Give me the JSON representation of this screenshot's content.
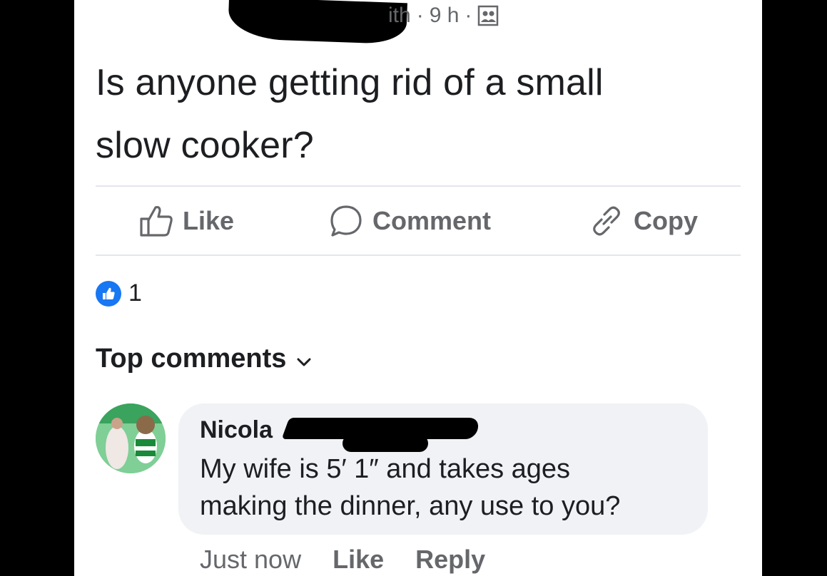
{
  "post": {
    "meta_name_fragment": "ith",
    "meta_time": "9 h",
    "text_line1": "Is anyone getting rid of a small",
    "text_line2": "slow cooker?"
  },
  "actions": {
    "like_label": "Like",
    "comment_label": "Comment",
    "copy_label": "Copy"
  },
  "reactions": {
    "count": "1"
  },
  "comments_section": {
    "label": "Top comments"
  },
  "comment": {
    "author": "Nicola",
    "text_line1": "My wife  is 5′ 1″ and takes ages",
    "text_line2": "making the dinner, any use to you?",
    "time": "Just now",
    "like_label": "Like",
    "reply_label": "Reply"
  },
  "icons": {
    "like": "thumbs-up-icon",
    "comment": "speech-bubble-icon",
    "copy": "link-icon",
    "audience": "friends-icon",
    "chevron": "chevron-down-icon"
  },
  "colors": {
    "background": "#000000",
    "panel": "#ffffff",
    "secondary_text": "#65676b",
    "primary_text": "#1c1e21",
    "accent": "#1877f2",
    "bubble": "#f0f2f5"
  }
}
